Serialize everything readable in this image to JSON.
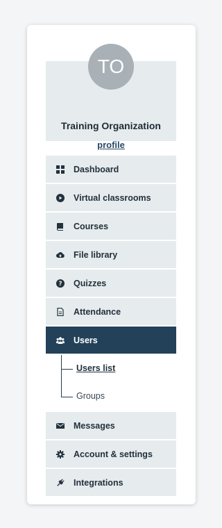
{
  "profile": {
    "avatar_initials": "TO",
    "org_name": "Training Organization",
    "profile_link": "profile"
  },
  "menu": {
    "items": [
      {
        "label": "Dashboard",
        "icon": "dashboard-grid-icon"
      },
      {
        "label": "Virtual classrooms",
        "icon": "play-circle-icon"
      },
      {
        "label": "Courses",
        "icon": "book-icon"
      },
      {
        "label": "File library",
        "icon": "cloud-upload-icon"
      },
      {
        "label": "Quizzes",
        "icon": "question-circle-icon"
      },
      {
        "label": "Attendance",
        "icon": "document-icon"
      },
      {
        "label": "Users",
        "icon": "users-icon",
        "active": true
      }
    ],
    "users_submenu": [
      {
        "label": "Users list",
        "current": true
      },
      {
        "label": "Groups"
      }
    ],
    "bottom_items": [
      {
        "label": "Messages",
        "icon": "envelope-icon"
      },
      {
        "label": "Account & settings",
        "icon": "gear-icon"
      },
      {
        "label": "Integrations",
        "icon": "plug-icon"
      }
    ]
  },
  "colors": {
    "active_bg": "#234259",
    "item_bg": "#e6ebee",
    "avatar_bg": "#a9b1b6"
  }
}
